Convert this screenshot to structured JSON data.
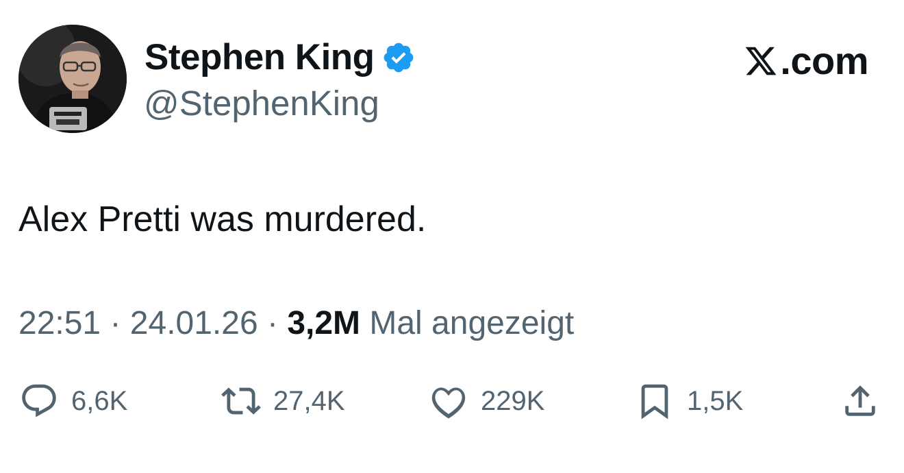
{
  "author": {
    "name": "Stephen King",
    "handle": "@StephenKing",
    "verified_icon": "verified-badge-icon",
    "verified_color": "#1d9bf0"
  },
  "brand": {
    "label": ".com",
    "logo_icon": "x-logo-icon"
  },
  "tweet": {
    "text": "Alex Pretti was murdered."
  },
  "meta": {
    "time": "22:51",
    "separator": "·",
    "date": "24.01.26",
    "views_count": "3,2M",
    "views_label": "Mal angezeigt"
  },
  "actions": {
    "replies": "6,6K",
    "reposts": "27,4K",
    "likes": "229K",
    "bookmarks": "1,5K"
  },
  "colors": {
    "text": "#0f1419",
    "secondary": "#536471",
    "accent": "#1d9bf0"
  }
}
